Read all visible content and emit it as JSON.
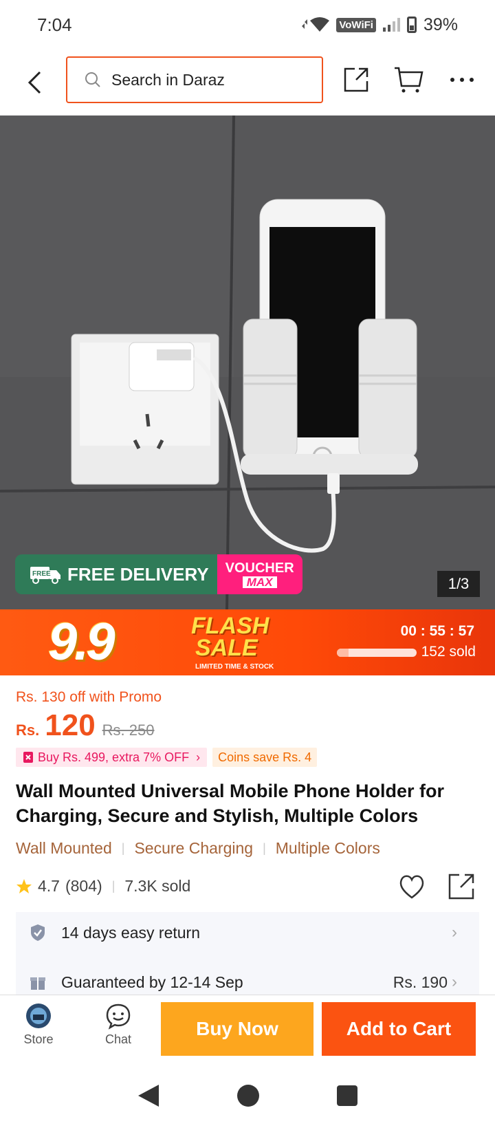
{
  "status_bar": {
    "time": "7:04",
    "network": "VoWiFi",
    "battery": "39%"
  },
  "header": {
    "search_placeholder": "Search in Daraz"
  },
  "gallery": {
    "free_delivery": "FREE DELIVERY",
    "free_tag": "FREE",
    "voucher_line1": "VOUCHER",
    "voucher_line2": "MAX",
    "counter": "1/3"
  },
  "flash_sale": {
    "event": "9.9",
    "title_line1": "FLASH",
    "title_line2": "SALE",
    "subtitle": "LIMITED TIME & STOCK",
    "timer": "00 : 55 : 57",
    "sold": "152 sold",
    "progress": 0.15
  },
  "price": {
    "promo": "Rs. 130 off with Promo",
    "currency": "Rs.",
    "amount": "120",
    "original": "Rs. 250",
    "deal": "Buy Rs. 499, extra 7% OFF",
    "coins": "Coins save Rs. 4"
  },
  "product": {
    "title": "Wall Mounted Universal Mobile Phone Holder for Charging, Secure and Stylish, Multiple Colors",
    "tags": [
      "Wall Mounted",
      "Secure Charging",
      "Multiple Colors"
    ],
    "rating": "4.7",
    "reviews": "(804)",
    "sold": "7.3K sold"
  },
  "services": {
    "return": "14 days easy return",
    "delivery": "Guaranteed by 12-14 Sep",
    "delivery_fee": "Rs. 190"
  },
  "bottom_bar": {
    "store": "Store",
    "chat": "Chat",
    "buy_now": "Buy Now",
    "add_to_cart": "Add to Cart"
  },
  "colors": {
    "accent": "#f0521c",
    "buy_now": "#fda61e",
    "add_cart": "#fb5311",
    "free_delivery": "#2f7b58",
    "voucher": "#ff1f7d"
  }
}
